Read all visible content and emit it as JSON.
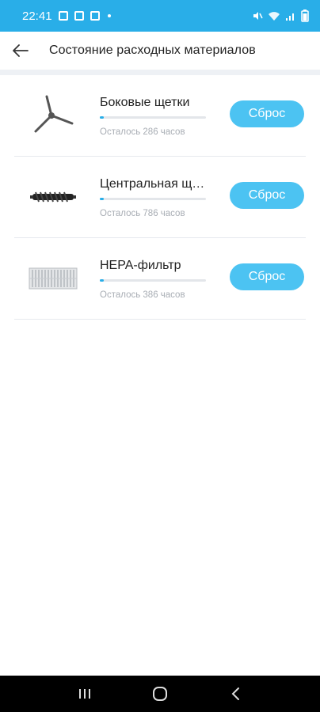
{
  "status_bar": {
    "time": "22:41",
    "icons_left": [
      "gallery-icon",
      "app-icon",
      "app-icon",
      "dot-icon"
    ],
    "icons_right": [
      "mute-icon",
      "wifi-icon",
      "signal-icon",
      "battery-icon"
    ]
  },
  "header": {
    "back_icon": "arrow-left-icon",
    "title": "Состояние расходных материалов"
  },
  "items": [
    {
      "name": "Боковые щетки",
      "remaining": "Осталось 286 часов",
      "progress": 0.04,
      "button": "Сброс",
      "image": "side-brush-image"
    },
    {
      "name": "Центральная щетка",
      "remaining": "Осталось 786 часов",
      "progress": 0.04,
      "button": "Сброс",
      "image": "main-brush-image"
    },
    {
      "name": "HEPA-фильтр",
      "remaining": "Осталось 386 часов",
      "progress": 0.04,
      "button": "Сброс",
      "image": "hepa-filter-image"
    }
  ],
  "nav_bar": [
    "recent-apps-icon",
    "home-icon",
    "back-icon"
  ],
  "colors": {
    "accent": "#29aee8",
    "button": "#4cc3f2",
    "muted_text": "#a8adb4"
  }
}
